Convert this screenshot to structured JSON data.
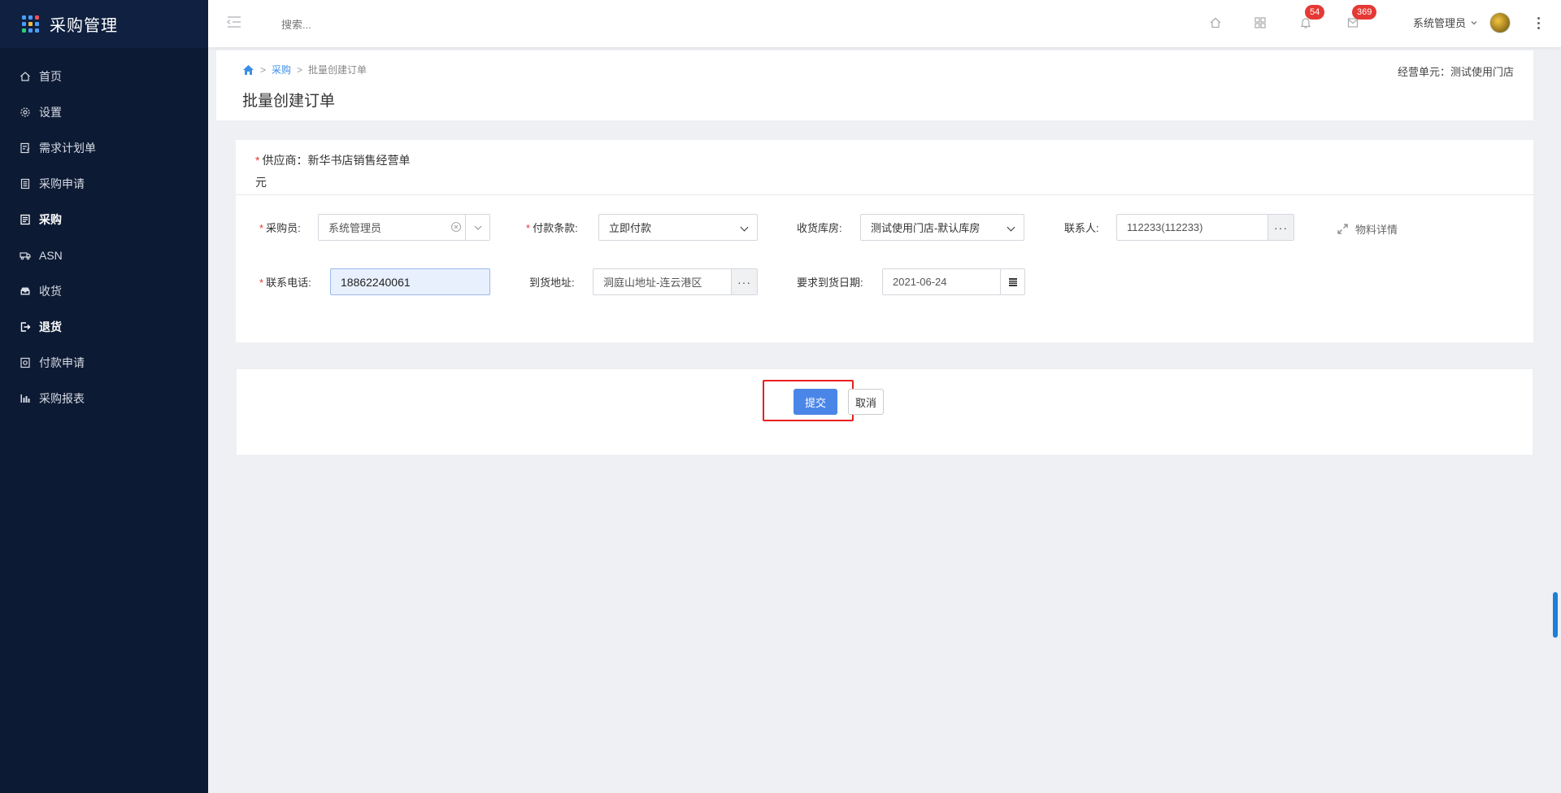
{
  "app": {
    "title": "采购管理"
  },
  "colors": {
    "sidebar_bg": "#0d1a33",
    "accent": "#4a86e8",
    "highlight": "#e82020",
    "badge": "#e53935"
  },
  "sidebar": {
    "items": [
      {
        "label": "首页",
        "icon": "home-icon"
      },
      {
        "label": "设置",
        "icon": "gear-icon"
      },
      {
        "label": "需求计划单",
        "icon": "document-edit-icon"
      },
      {
        "label": "采购申请",
        "icon": "receipt-icon"
      },
      {
        "label": "采购",
        "icon": "list-icon"
      },
      {
        "label": "ASN",
        "icon": "truck-icon"
      },
      {
        "label": "收货",
        "icon": "inbox-icon"
      },
      {
        "label": "退货",
        "icon": "return-icon"
      },
      {
        "label": "付款申请",
        "icon": "payment-icon"
      },
      {
        "label": "采购报表",
        "icon": "bar-chart-icon"
      }
    ]
  },
  "topbar": {
    "search_placeholder": "搜索...",
    "notifications": "54",
    "messages": "369",
    "user": "系统管理员"
  },
  "header": {
    "breadcrumb": {
      "section": "采购",
      "current": "批量创建订单"
    },
    "business_unit": "经营单元：测试使用门店",
    "title": "批量创建订单"
  },
  "form": {
    "supplier": "供应商：新华书店销售经营单元",
    "buyer_label": "采购员:",
    "buyer_value": "系统管理员",
    "payment_label": "付款条款:",
    "payment_value": "立即付款",
    "warehouse_label": "收货库房:",
    "warehouse_value": "测试使用门店-默认库房",
    "contact_label": "联系人:",
    "contact_value": "112233(112233)",
    "material_detail": "物料详情",
    "phone_label": "联系电话:",
    "phone_value": "18862240061",
    "address_label": "到货地址:",
    "address_value": "洞庭山地址-连云港区",
    "date_label": "要求到货日期:",
    "date_value": "2021-06-24",
    "ellipsis": "···"
  },
  "actions": {
    "submit": "提交",
    "cancel": "取消"
  }
}
